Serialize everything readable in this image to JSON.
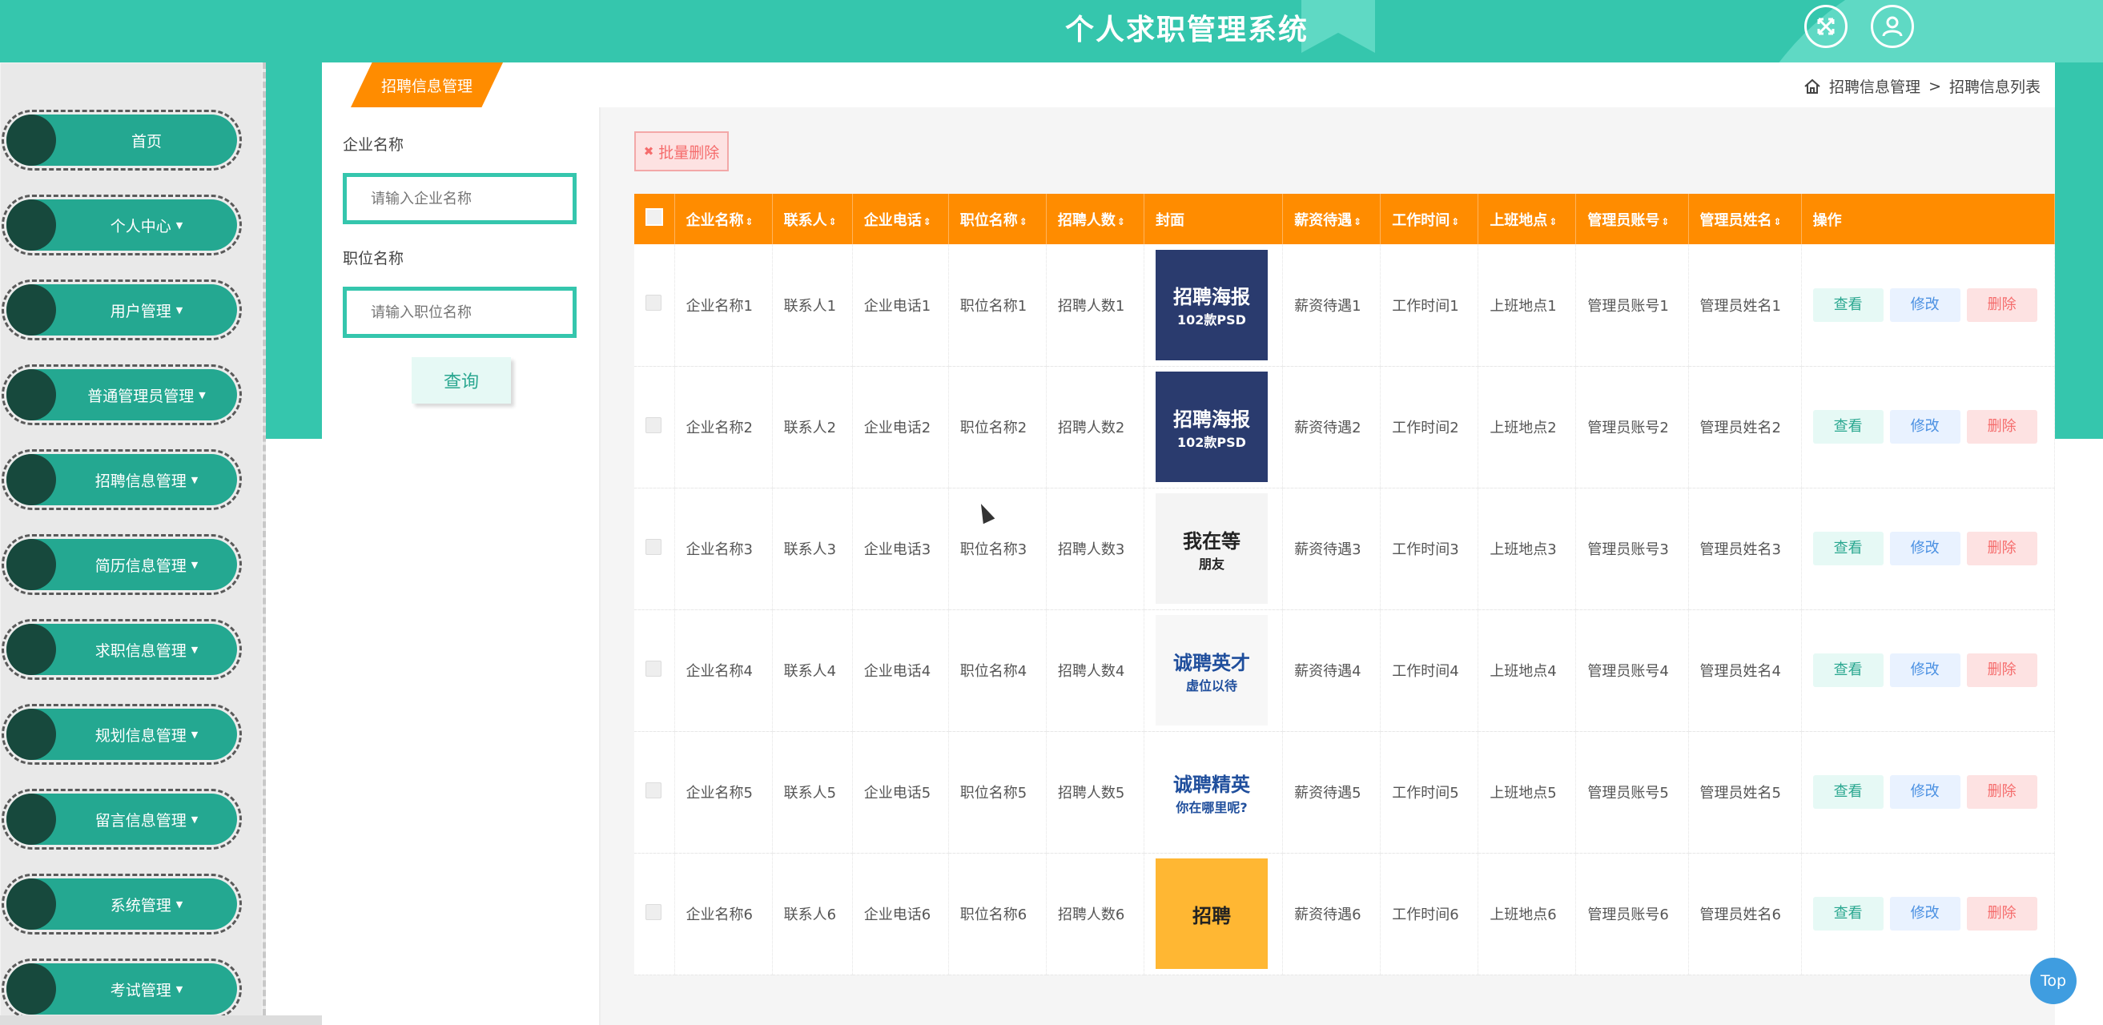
{
  "header": {
    "app_title": "个人求职管理系统",
    "icons": [
      "fullscreen-icon",
      "user-icon"
    ]
  },
  "sidebar": {
    "items": [
      {
        "label": "首页",
        "has_caret": false
      },
      {
        "label": "个人中心",
        "has_caret": true
      },
      {
        "label": "用户管理",
        "has_caret": true
      },
      {
        "label": "普通管理员管理",
        "has_caret": true
      },
      {
        "label": "招聘信息管理",
        "has_caret": true
      },
      {
        "label": "简历信息管理",
        "has_caret": true
      },
      {
        "label": "求职信息管理",
        "has_caret": true
      },
      {
        "label": "规划信息管理",
        "has_caret": true
      },
      {
        "label": "留言信息管理",
        "has_caret": true
      },
      {
        "label": "系统管理",
        "has_caret": true
      },
      {
        "label": "考试管理",
        "has_caret": true
      }
    ],
    "caret_glyph": "▼"
  },
  "panel": {
    "tab_label": "招聘信息管理",
    "breadcrumb": {
      "first": "招聘信息管理",
      "separator": ">",
      "second": "招聘信息列表"
    }
  },
  "search": {
    "company_label": "企业名称",
    "company_placeholder": "请输入企业名称",
    "position_label": "职位名称",
    "position_placeholder": "请输入职位名称",
    "query_button": "查询"
  },
  "toolbar": {
    "batch_delete_label": "批量删除"
  },
  "table": {
    "sort_glyph": "⇕",
    "headers": [
      "企业名称",
      "联系人",
      "企业电话",
      "职位名称",
      "招聘人数",
      "封面",
      "薪资待遇",
      "工作时间",
      "上班地点",
      "管理员账号",
      "管理员姓名",
      "操作"
    ],
    "rows": [
      {
        "company": "企业名称1",
        "contact": "联系人1",
        "phone": "企业电话1",
        "position": "职位名称1",
        "count": "招聘人数1",
        "salary": "薪资待遇1",
        "worktime": "工作时间1",
        "location": "上班地点1",
        "admin_account": "管理员账号1",
        "admin_name": "管理员姓名1"
      },
      {
        "company": "企业名称2",
        "contact": "联系人2",
        "phone": "企业电话2",
        "position": "职位名称2",
        "count": "招聘人数2",
        "salary": "薪资待遇2",
        "worktime": "工作时间2",
        "location": "上班地点2",
        "admin_account": "管理员账号2",
        "admin_name": "管理员姓名2"
      },
      {
        "company": "企业名称3",
        "contact": "联系人3",
        "phone": "企业电话3",
        "position": "职位名称3",
        "count": "招聘人数3",
        "salary": "薪资待遇3",
        "worktime": "工作时间3",
        "location": "上班地点3",
        "admin_account": "管理员账号3",
        "admin_name": "管理员姓名3"
      },
      {
        "company": "企业名称4",
        "contact": "联系人4",
        "phone": "企业电话4",
        "position": "职位名称4",
        "count": "招聘人数4",
        "salary": "薪资待遇4",
        "worktime": "工作时间4",
        "location": "上班地点4",
        "admin_account": "管理员账号4",
        "admin_name": "管理员姓名4"
      },
      {
        "company": "企业名称5",
        "contact": "联系人5",
        "phone": "企业电话5",
        "position": "职位名称5",
        "count": "招聘人数5",
        "salary": "薪资待遇5",
        "worktime": "工作时间5",
        "location": "上班地点5",
        "admin_account": "管理员账号5",
        "admin_name": "管理员姓名5"
      },
      {
        "company": "企业名称6",
        "contact": "联系人6",
        "phone": "企业电话6",
        "position": "职位名称6",
        "count": "招聘人数6",
        "salary": "薪资待遇6",
        "worktime": "工作时间6",
        "location": "上班地点6",
        "admin_account": "管理员账号6",
        "admin_name": "管理员姓名6"
      }
    ],
    "covers": [
      {
        "line1": "招聘海报",
        "line2": "102款PSD",
        "bg": "#2a3b6e",
        "fg": "#ffffff"
      },
      {
        "line1": "招聘海报",
        "line2": "102款PSD",
        "bg": "#2a3b6e",
        "fg": "#ffffff"
      },
      {
        "line1": "我在等",
        "line2": "朋友",
        "bg": "#f4f4f4",
        "fg": "#222222"
      },
      {
        "line1": "诚聘英才",
        "line2": "虚位以待",
        "bg": "#f7f7f7",
        "fg": "#1f4e9c"
      },
      {
        "line1": "诚聘精英",
        "line2": "你在哪里呢?",
        "bg": "#ffffff",
        "fg": "#1f4e9c"
      },
      {
        "line1": "招聘",
        "line2": "",
        "bg": "#ffb733",
        "fg": "#222222"
      }
    ],
    "actions": {
      "view": "查看",
      "edit": "修改",
      "delete": "删除"
    }
  },
  "floating": {
    "top_button": "Top"
  },
  "colors": {
    "brand": "#35c6ad",
    "brand_dark": "#24a891",
    "table_header": "#ff8c00",
    "danger": "#f56c6c",
    "info": "#4a90e2"
  }
}
